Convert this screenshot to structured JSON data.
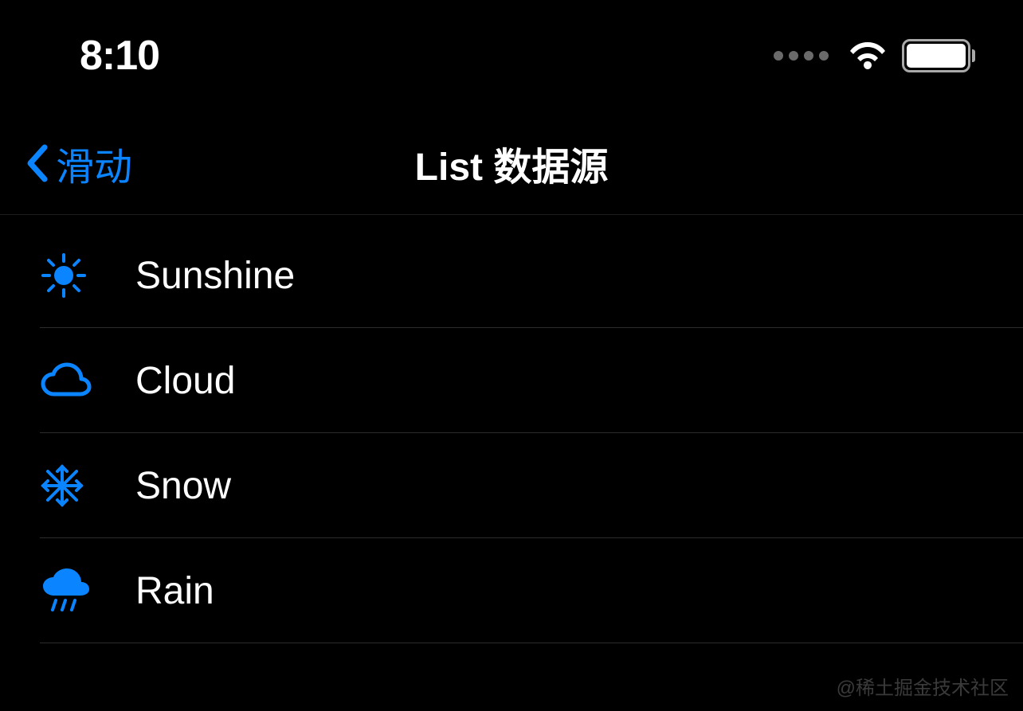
{
  "status": {
    "time": "8:10"
  },
  "nav": {
    "back_label": "滑动",
    "title": "List 数据源"
  },
  "list": {
    "items": [
      {
        "icon": "sun",
        "label": "Sunshine"
      },
      {
        "icon": "cloud",
        "label": "Cloud"
      },
      {
        "icon": "snowflake",
        "label": "Snow"
      },
      {
        "icon": "rain",
        "label": "Rain"
      }
    ]
  },
  "watermark": "@稀土掘金技术社区",
  "colors": {
    "accent": "#0a84ff",
    "background": "#000000",
    "text": "#ffffff"
  }
}
